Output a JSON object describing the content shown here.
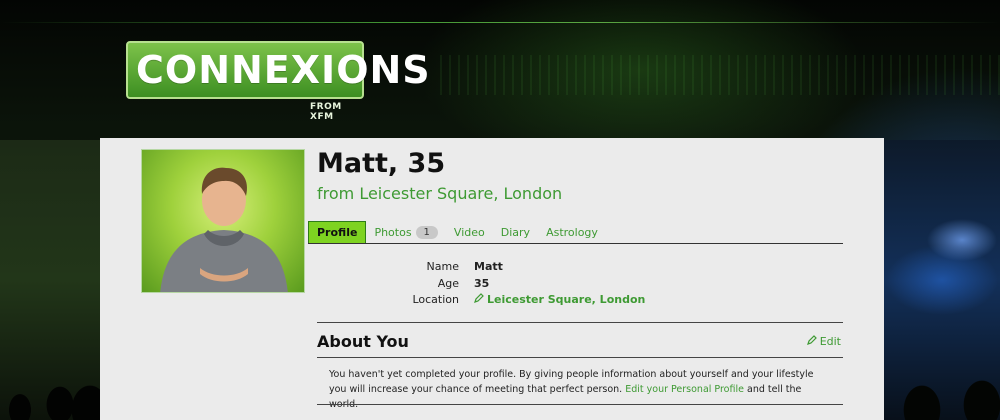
{
  "logo": {
    "text": "CONNEXIONS",
    "subtext": "FROM XFM"
  },
  "profile": {
    "name_age": "Matt, 35",
    "from": "from Leicester Square, London"
  },
  "tabs": [
    {
      "label": "Profile",
      "active": true
    },
    {
      "label": "Photos",
      "badge": "1"
    },
    {
      "label": "Video"
    },
    {
      "label": "Diary"
    },
    {
      "label": "Astrology"
    }
  ],
  "info": {
    "name_label": "Name",
    "name_value": "Matt",
    "age_label": "Age",
    "age_value": "35",
    "location_label": "Location",
    "location_value": "Leicester Square, London"
  },
  "about": {
    "title": "About You",
    "edit_label": "Edit",
    "text_before": "You haven't yet completed your profile. By giving people information about yourself and your lifestyle you will increase your chance of meeting that perfect person.",
    "link": "Edit your Personal Profile",
    "text_after": "and tell the world."
  },
  "colors": {
    "accent": "#3e9a33",
    "tab_active": "#7ed321",
    "panel": "#ebebeb"
  },
  "icons": {
    "edit": "pencil-icon"
  }
}
